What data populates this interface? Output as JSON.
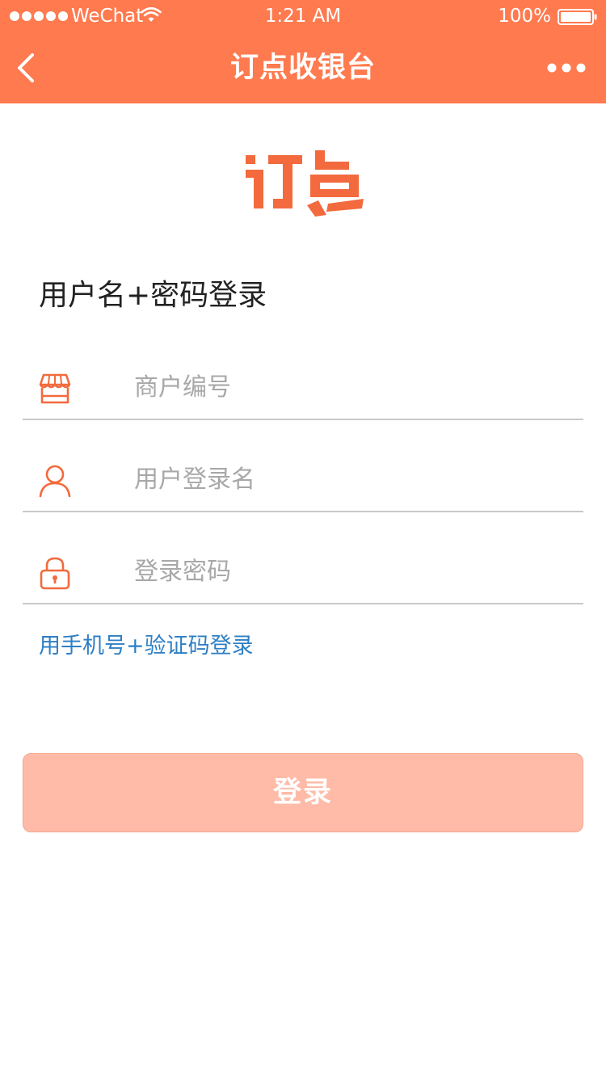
{
  "status_bar": {
    "carrier": "WeChat",
    "time": "1:21 AM",
    "battery": "100%"
  },
  "nav": {
    "title": "订点收银台",
    "back_icon": "chevron-left-icon",
    "more_icon": "more-dots-icon"
  },
  "brand": {
    "logo_text": "订点",
    "color": "#F26A3D"
  },
  "login": {
    "section_title": "用户名+密码登录",
    "fields": [
      {
        "icon": "store-icon",
        "placeholder": "商户编号",
        "value": ""
      },
      {
        "icon": "user-icon",
        "placeholder": "用户登录名",
        "value": ""
      },
      {
        "icon": "lock-icon",
        "placeholder": "登录密码",
        "value": ""
      }
    ],
    "alt_login_link": "用手机号+验证码登录",
    "submit_label": "登录"
  },
  "colors": {
    "header": "#FF7A4F",
    "accent": "#F26A3D",
    "link": "#2E7FC4",
    "button_disabled": "#FFBBA7"
  }
}
